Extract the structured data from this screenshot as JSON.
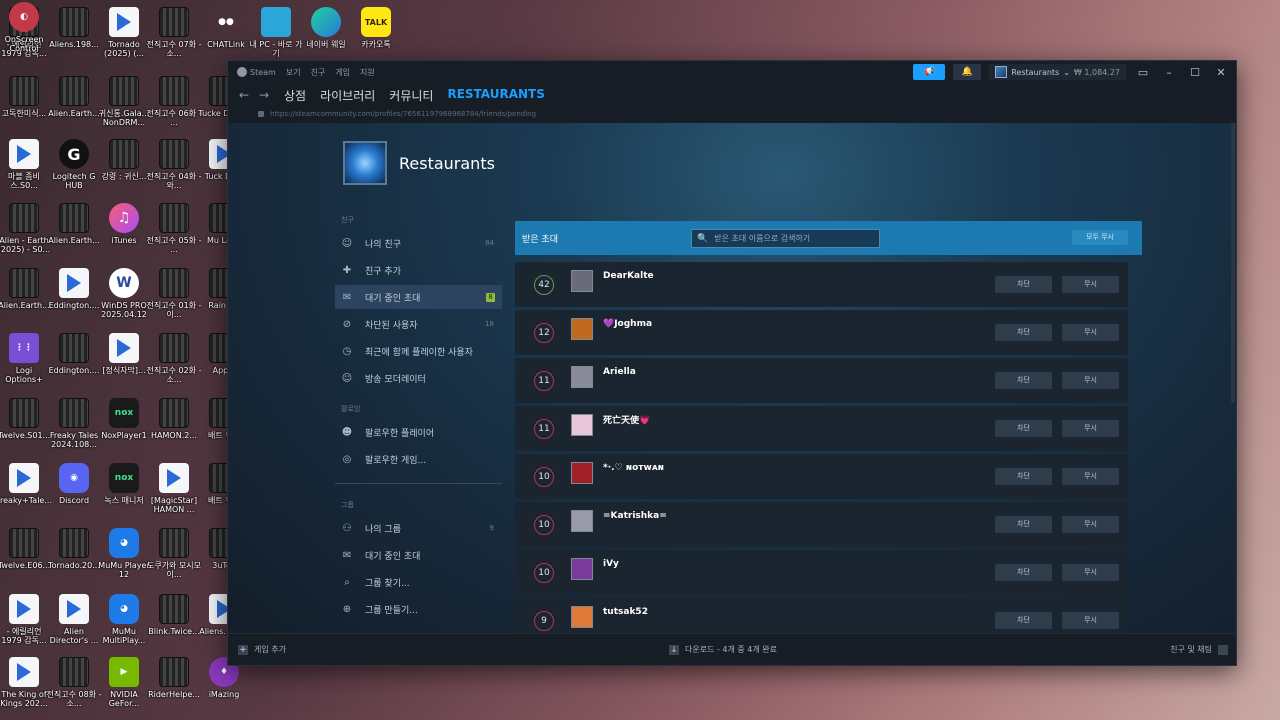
{
  "desktop": {
    "icons": [
      {
        "label": "- 에릴리언 1979 감독..."
      },
      {
        "label": "Aliens.198..."
      },
      {
        "label": "Tornado (2025) (..."
      },
      {
        "label": "전직고수 07화 - 소..."
      },
      {
        "label": "CHATLink"
      },
      {
        "label": "내 PC - 바로 가기"
      },
      {
        "label": "네이버 웨일"
      },
      {
        "label": "카카오톡"
      },
      {
        "label": "고독한미식..."
      },
      {
        "label": "Alien.Earth..."
      },
      {
        "label": "귀신통.Gala... NonDRM..."
      },
      {
        "label": "전직고수 06화 - ..."
      },
      {
        "label": "Tucke Dale V"
      },
      {
        "label": "마블 좀비스.S0..."
      },
      {
        "label": "Logitech G HUB"
      },
      {
        "label": "강령 : 귀신..."
      },
      {
        "label": "전직고수 04화 - 와..."
      },
      {
        "label": "Tuck Dale"
      },
      {
        "label": "Alien - Earth (2025) - S0..."
      },
      {
        "label": "Alien.Earth..."
      },
      {
        "label": "iTunes"
      },
      {
        "label": "전직고수 05화 - ..."
      },
      {
        "label": "Mu Laun"
      },
      {
        "label": "Alien.Earth..."
      },
      {
        "label": "Eddington...."
      },
      {
        "label": "WinDS PRO 2025.04.12"
      },
      {
        "label": "전직고수 01화 - 이..."
      },
      {
        "label": "Rain+M"
      },
      {
        "label": "Logi Options+"
      },
      {
        "label": "Eddington...."
      },
      {
        "label": "[정식자막]..."
      },
      {
        "label": "전직고수 02화 - 소..."
      },
      {
        "label": "Apple"
      },
      {
        "label": "Twelve.S01..."
      },
      {
        "label": "Freaky Tales 2024.108..."
      },
      {
        "label": "NoxPlayer1"
      },
      {
        "label": "HAMON.2..."
      },
      {
        "label": "배트 유렉"
      },
      {
        "label": "Freaky+Tale..."
      },
      {
        "label": "Discord"
      },
      {
        "label": "녹스 매니저"
      },
      {
        "label": "[MagicStar] HAMON ..."
      },
      {
        "label": "배트 유렉"
      },
      {
        "label": "Twelve.E06..."
      },
      {
        "label": "Tornado.20..."
      },
      {
        "label": "MuMu Player 12"
      },
      {
        "label": "도쿠가와 모시모 이..."
      },
      {
        "label": "3uToo"
      },
      {
        "label": "- 에릴리언 1979 감독..."
      },
      {
        "label": "Alien Director's ..."
      },
      {
        "label": "MuMu MultiPlay..."
      },
      {
        "label": "Blink.Twice..."
      },
      {
        "label": "Aliens.198..."
      },
      {
        "label": "The King of Kings 202..."
      },
      {
        "label": "전직고수 08화 - 소..."
      },
      {
        "label": "NVIDIA GeFor..."
      },
      {
        "label": "RiderHelpe..."
      },
      {
        "label": "iMazing"
      },
      {
        "label": "OnScreen Control"
      }
    ]
  },
  "window": {
    "menu": [
      "Steam",
      "보기",
      "친구",
      "게임",
      "지원"
    ],
    "account_name": "Restaurants",
    "wallet": "₩ 1,084.27",
    "nav": [
      "상점",
      "라이브러리",
      "커뮤니티"
    ],
    "nav_active": "RESTAURANTS",
    "url": "https://steamcommunity.com/profiles/76561197968968784/friends/pending"
  },
  "profile": {
    "name": "Restaurants"
  },
  "sidebar": {
    "friends_title": "친구",
    "friends": [
      {
        "label": "나의 친구",
        "count": "84",
        "icon": "person-icon"
      },
      {
        "label": "친구 추가",
        "count": "",
        "icon": "add-person-icon"
      },
      {
        "label": "대기 중인 초대",
        "count": "8",
        "icon": "envelope-icon"
      },
      {
        "label": "차단된 사용자",
        "count": "18",
        "icon": "block-icon"
      },
      {
        "label": "최근에 함께 플레이한 사용자",
        "count": "",
        "icon": "clock-icon"
      },
      {
        "label": "방송 모더레이터",
        "count": "",
        "icon": "person-icon"
      }
    ],
    "following_title": "팔로잉",
    "following": [
      {
        "label": "팔로우한 플레이어",
        "icon": "follow-icon"
      },
      {
        "label": "팔로우한 게임...",
        "icon": "game-icon"
      }
    ],
    "groups_title": "그룹",
    "groups": [
      {
        "label": "나의 그룹",
        "count": "9",
        "icon": "group-icon"
      },
      {
        "label": "대기 중인 초대",
        "count": "",
        "icon": "envelope-icon"
      },
      {
        "label": "그룹 찾기...",
        "count": "",
        "icon": "search-icon"
      },
      {
        "label": "그룹 만들기...",
        "count": "",
        "icon": "plus-icon"
      }
    ]
  },
  "invites": {
    "title": "받은 초대",
    "search_placeholder": "받은 초대 이름으로 검색하기",
    "ignore_all": "모두 무시",
    "block_label": "차단",
    "ignore_label": "무시",
    "rows": [
      {
        "level": "42",
        "name": "DearKalte",
        "ring": "#5a9a50"
      },
      {
        "level": "12",
        "name": "💜Joghma",
        "ring": "#c0304a"
      },
      {
        "level": "11",
        "name": "Ariella",
        "ring": "#c0304a"
      },
      {
        "level": "11",
        "name": "死亡天使💗",
        "ring": "#c0304a"
      },
      {
        "level": "10",
        "name": "*·.♡ ɴᴏᴛᴡᴀɴ",
        "ring": "#c0304a"
      },
      {
        "level": "10",
        "name": "=Katrishka=",
        "ring": "#c0304a"
      },
      {
        "level": "10",
        "name": "iVy",
        "ring": "#c0304a"
      },
      {
        "level": "9",
        "name": "tutsak52",
        "ring": "#c0304a"
      }
    ]
  },
  "statusbar": {
    "add_game": "게임 추가",
    "download": "다운로드 - 4개 중 4개 완료",
    "friends_chat": "친구 및 채팅"
  },
  "colors": {
    "accent": "#1a9fff",
    "header_blue": "#1d7ab0",
    "bg": "#171d25",
    "pending_badge": "#90ba3c"
  }
}
